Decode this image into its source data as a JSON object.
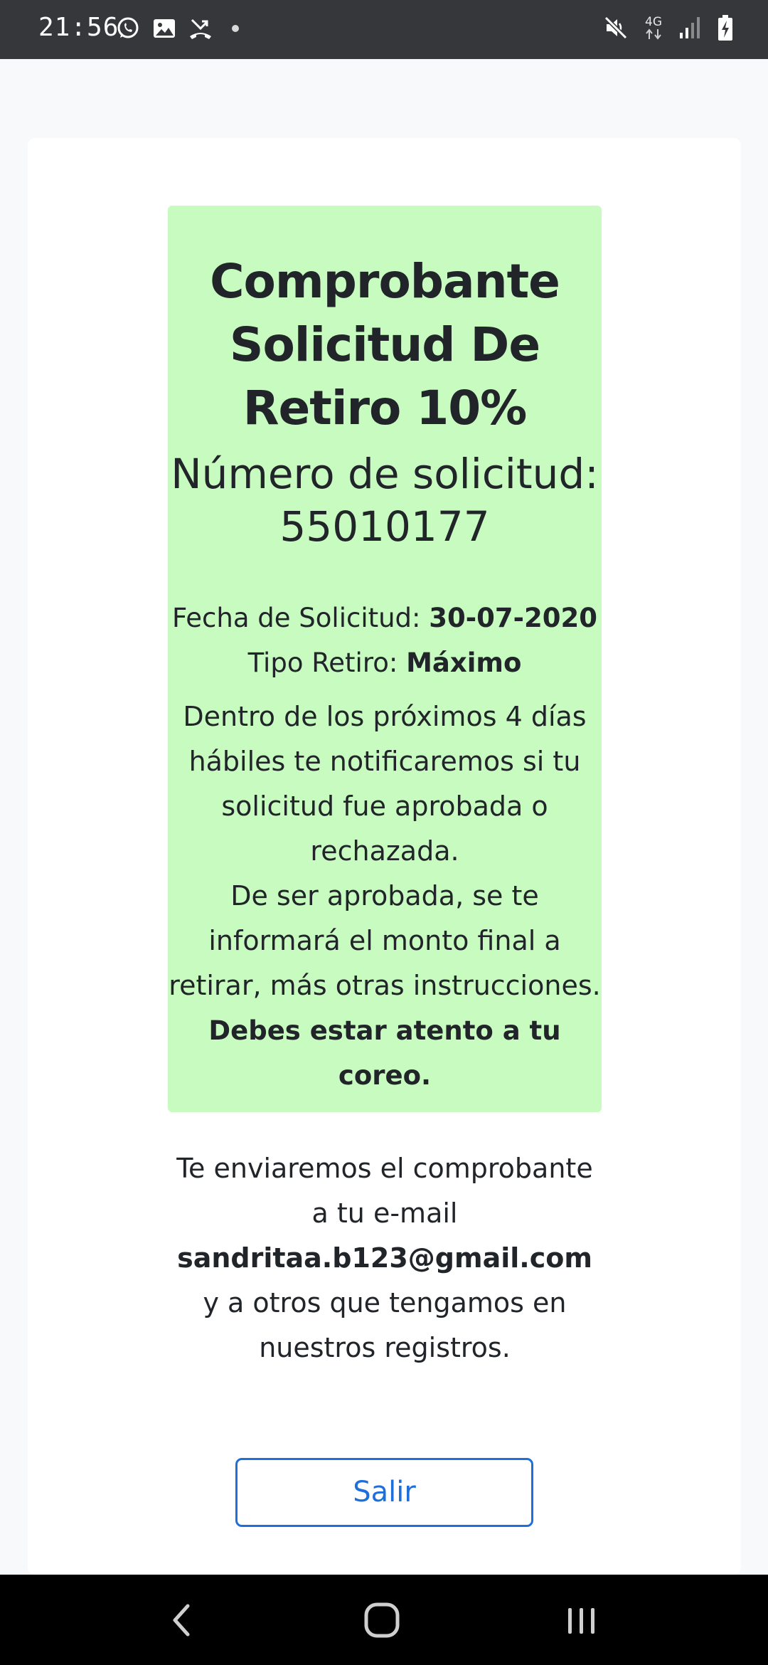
{
  "status_bar": {
    "time": "21:56",
    "network_label": "4G",
    "icons": [
      "whatsapp-icon",
      "gallery-icon",
      "missed-call-icon",
      "notification-dot-icon",
      "mute-icon",
      "data-arrows-icon",
      "signal-icon",
      "battery-charging-icon"
    ]
  },
  "receipt": {
    "title": "Comprobante Solicitud De Retiro 10%",
    "request_number_label": "Número de solicitud:",
    "request_number": "55010177",
    "date_label": "Fecha de Solicitud:",
    "date_value": "30-07-2020",
    "type_label": "Tipo Retiro:",
    "type_value": "Máximo",
    "notice_1": "Dentro de los próximos 4 días hábiles te notificaremos si tu solicitud fue aprobada o rechazada.",
    "notice_2": "De ser aprobada, se te informará el monto final a retirar, más otras instrucciones.",
    "notice_3": "Debes estar atento a tu coreo."
  },
  "email_notice": {
    "text_before": "Te enviaremos el comprobante a tu e-mail",
    "email": "sandritaa.b123@gmail.com",
    "text_after": "y a otros que tengamos en nuestros registros."
  },
  "actions": {
    "exit_label": "Salir"
  },
  "colors": {
    "status_bar": "#36373b",
    "receipt_background": "#c8fbc0",
    "accent": "#1e6fd9",
    "page_background": "#f8f9fa"
  },
  "nav_bar": {
    "icons": [
      "back-icon",
      "home-icon",
      "recents-icon"
    ]
  }
}
